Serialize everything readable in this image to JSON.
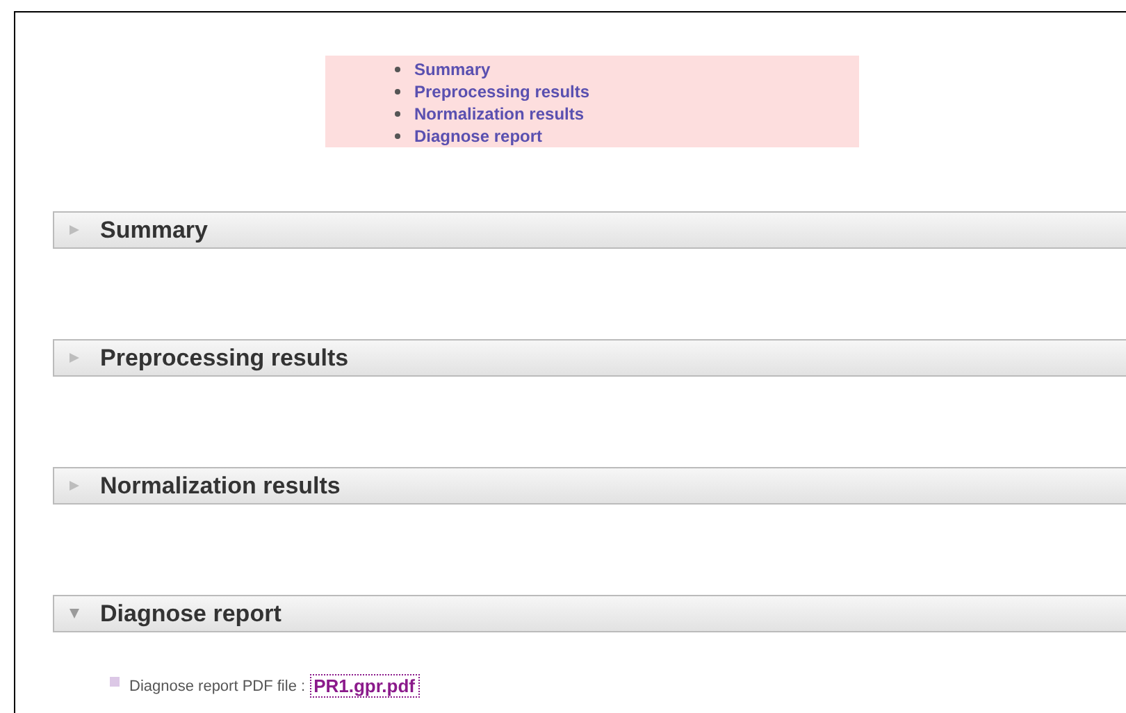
{
  "toc": [
    {
      "label": "Summary"
    },
    {
      "label": "Preprocessing results"
    },
    {
      "label": "Normalization results"
    },
    {
      "label": "Diagnose report"
    }
  ],
  "sections": [
    {
      "title": "Summary",
      "expanded": false
    },
    {
      "title": "Preprocessing results",
      "expanded": false
    },
    {
      "title": "Normalization results",
      "expanded": false
    },
    {
      "title": "Diagnose report",
      "expanded": true,
      "items": [
        {
          "label": "Diagnose report PDF file :",
          "link": "PR1.gpr.pdf"
        }
      ]
    }
  ]
}
